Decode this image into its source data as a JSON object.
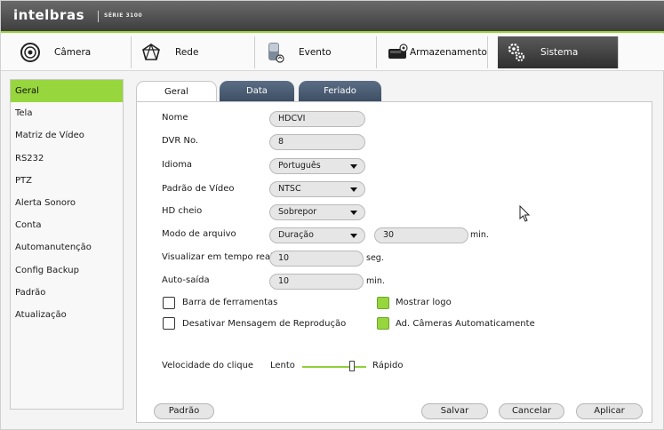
{
  "brand": {
    "name": "intelbras",
    "series": "SÉRIE 3100"
  },
  "topnav": [
    {
      "label": "Câmera",
      "icon": "camera-icon"
    },
    {
      "label": "Rede",
      "icon": "network-icon"
    },
    {
      "label": "Evento",
      "icon": "event-icon"
    },
    {
      "label": "Armazenamento",
      "icon": "storage-icon"
    },
    {
      "label": "Sistema",
      "icon": "gears-icon",
      "active": true
    }
  ],
  "sidebar": {
    "items": [
      {
        "label": "Geral",
        "active": true
      },
      {
        "label": "Tela"
      },
      {
        "label": "Matriz de Vídeo"
      },
      {
        "label": "RS232"
      },
      {
        "label": "PTZ"
      },
      {
        "label": "Alerta Sonoro"
      },
      {
        "label": "Conta"
      },
      {
        "label": "Automanutenção"
      },
      {
        "label": "Config Backup"
      },
      {
        "label": "Padrão"
      },
      {
        "label": "Atualização"
      }
    ]
  },
  "tabs": [
    {
      "label": "Geral",
      "active": true
    },
    {
      "label": "Data"
    },
    {
      "label": "Feriado"
    }
  ],
  "form": {
    "nome": {
      "label": "Nome",
      "value": "HDCVI"
    },
    "dvr_no": {
      "label": "DVR No.",
      "value": "8"
    },
    "idioma": {
      "label": "Idioma",
      "value": "Português"
    },
    "padrao_video": {
      "label": "Padrão de Vídeo",
      "value": "NTSC"
    },
    "hd_cheio": {
      "label": "HD cheio",
      "value": "Sobrepor"
    },
    "modo_arquivo": {
      "label": "Modo de arquivo",
      "value": "Duração",
      "minutes": "30",
      "unit": "min."
    },
    "visualizar": {
      "label": "Visualizar em tempo real",
      "value": "10",
      "unit": "seg."
    },
    "auto_saida": {
      "label": "Auto-saída",
      "value": "10",
      "unit": "min."
    },
    "checkboxes": {
      "barra": {
        "label": "Barra de ferramentas",
        "checked": false
      },
      "desativar": {
        "label": "Desativar Mensagem de Reprodução",
        "checked": false
      },
      "mostrar_logo": {
        "label": "Mostrar logo",
        "checked": true
      },
      "ad_cameras": {
        "label": "Ad. Câmeras Automaticamente",
        "checked": true
      }
    },
    "velocidade": {
      "label": "Velocidade do clique",
      "slow": "Lento",
      "fast": "Rápido"
    }
  },
  "buttons": {
    "padrao": "Padrão",
    "salvar": "Salvar",
    "cancelar": "Cancelar",
    "aplicar": "Aplicar"
  },
  "colors": {
    "accent": "#97d63c",
    "tab_inactive": "#4b5d74",
    "header_dark": "#3e3e3e"
  }
}
